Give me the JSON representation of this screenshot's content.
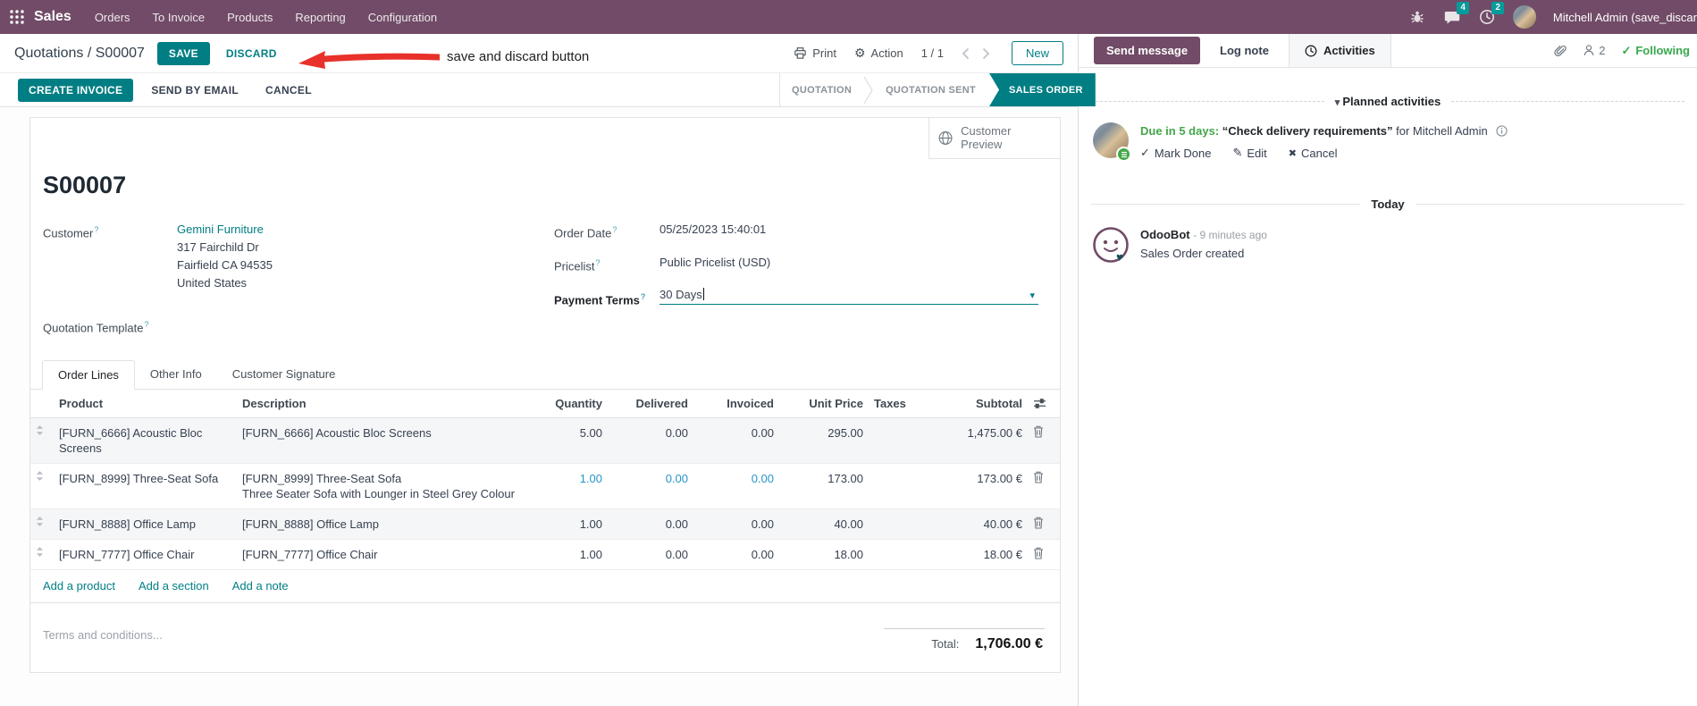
{
  "colors": {
    "brand_purple": "#714B67",
    "accent_teal": "#017E84",
    "badge_teal": "#00A09D",
    "success_green": "#44A748",
    "highlight_blue": "#2795C9",
    "annotation_red": "#E8312A"
  },
  "topbar": {
    "app": "Sales",
    "menus": [
      "Orders",
      "To Invoice",
      "Products",
      "Reporting",
      "Configuration"
    ],
    "message_count": "4",
    "activity_count": "2",
    "user": "Mitchell Admin (save_discar"
  },
  "control": {
    "breadcrumb_parent": "Quotations",
    "breadcrumb_sep": "/",
    "breadcrumb_current": "S00007",
    "save": "SAVE",
    "discard": "DISCARD",
    "annotation": "save and discard button",
    "print": "Print",
    "action": "Action",
    "pager": "1 / 1",
    "new": "New"
  },
  "statusbar": {
    "create_invoice": "CREATE INVOICE",
    "send_by_email": "SEND BY EMAIL",
    "cancel": "CANCEL",
    "stages": [
      {
        "label": "QUOTATION",
        "active": false
      },
      {
        "label": "QUOTATION SENT",
        "active": false
      },
      {
        "label": "SALES ORDER",
        "active": true
      }
    ]
  },
  "sheet": {
    "preview_button": "Customer Preview",
    "title": "S00007",
    "help_marker": "?",
    "fields": {
      "customer_label": "Customer",
      "customer_value": "Gemini Furniture",
      "address_lines": [
        "317 Fairchild Dr",
        "Fairfield CA 94535",
        "United States"
      ],
      "quotation_template_label": "Quotation Template",
      "order_date_label": "Order Date",
      "order_date_value": "05/25/2023 15:40:01",
      "pricelist_label": "Pricelist",
      "pricelist_value": "Public Pricelist (USD)",
      "payment_terms_label": "Payment Terms",
      "payment_terms_value": "30 Days"
    },
    "tabs": [
      {
        "label": "Order Lines",
        "active": true
      },
      {
        "label": "Other Info",
        "active": false
      },
      {
        "label": "Customer Signature",
        "active": false
      }
    ],
    "table": {
      "columns": [
        "Product",
        "Description",
        "Quantity",
        "Delivered",
        "Invoiced",
        "Unit Price",
        "Taxes",
        "Subtotal"
      ],
      "rows": [
        {
          "product": "[FURN_6666] Acoustic Bloc Screens",
          "description": [
            "[FURN_6666] Acoustic Bloc Screens"
          ],
          "quantity": "5.00",
          "delivered": "0.00",
          "invoiced": "0.00",
          "unit_price": "295.00",
          "taxes": "",
          "subtotal": "1,475.00 €",
          "highlight": false
        },
        {
          "product": "[FURN_8999] Three-Seat Sofa",
          "description": [
            "[FURN_8999] Three-Seat Sofa",
            "Three Seater Sofa with Lounger in Steel Grey Colour"
          ],
          "quantity": "1.00",
          "delivered": "0.00",
          "invoiced": "0.00",
          "unit_price": "173.00",
          "taxes": "",
          "subtotal": "173.00 €",
          "highlight": true
        },
        {
          "product": "[FURN_8888] Office Lamp",
          "description": [
            "[FURN_8888] Office Lamp"
          ],
          "quantity": "1.00",
          "delivered": "0.00",
          "invoiced": "0.00",
          "unit_price": "40.00",
          "taxes": "",
          "subtotal": "40.00 €",
          "highlight": false
        },
        {
          "product": "[FURN_7777] Office Chair",
          "description": [
            "[FURN_7777] Office Chair"
          ],
          "quantity": "1.00",
          "delivered": "0.00",
          "invoiced": "0.00",
          "unit_price": "18.00",
          "taxes": "",
          "subtotal": "18.00 €",
          "highlight": false
        }
      ],
      "footer_links": [
        "Add a product",
        "Add a section",
        "Add a note"
      ]
    },
    "terms_placeholder": "Terms and conditions...",
    "total_label": "Total:",
    "total_value": "1,706.00 €"
  },
  "chatter": {
    "send_message": "Send message",
    "log_note": "Log note",
    "activities": "Activities",
    "follower_count": "2",
    "following": "Following",
    "planned_title": "Planned activities",
    "activity": {
      "due": "Due in 5 days:",
      "summary": "“Check delivery requirements”",
      "for_text": "for Mitchell Admin",
      "mark_done": "Mark Done",
      "edit": "Edit",
      "cancel": "Cancel"
    },
    "today": "Today",
    "message": {
      "author": "OdooBot",
      "time": "- 9 minutes ago",
      "body": "Sales Order created"
    }
  }
}
